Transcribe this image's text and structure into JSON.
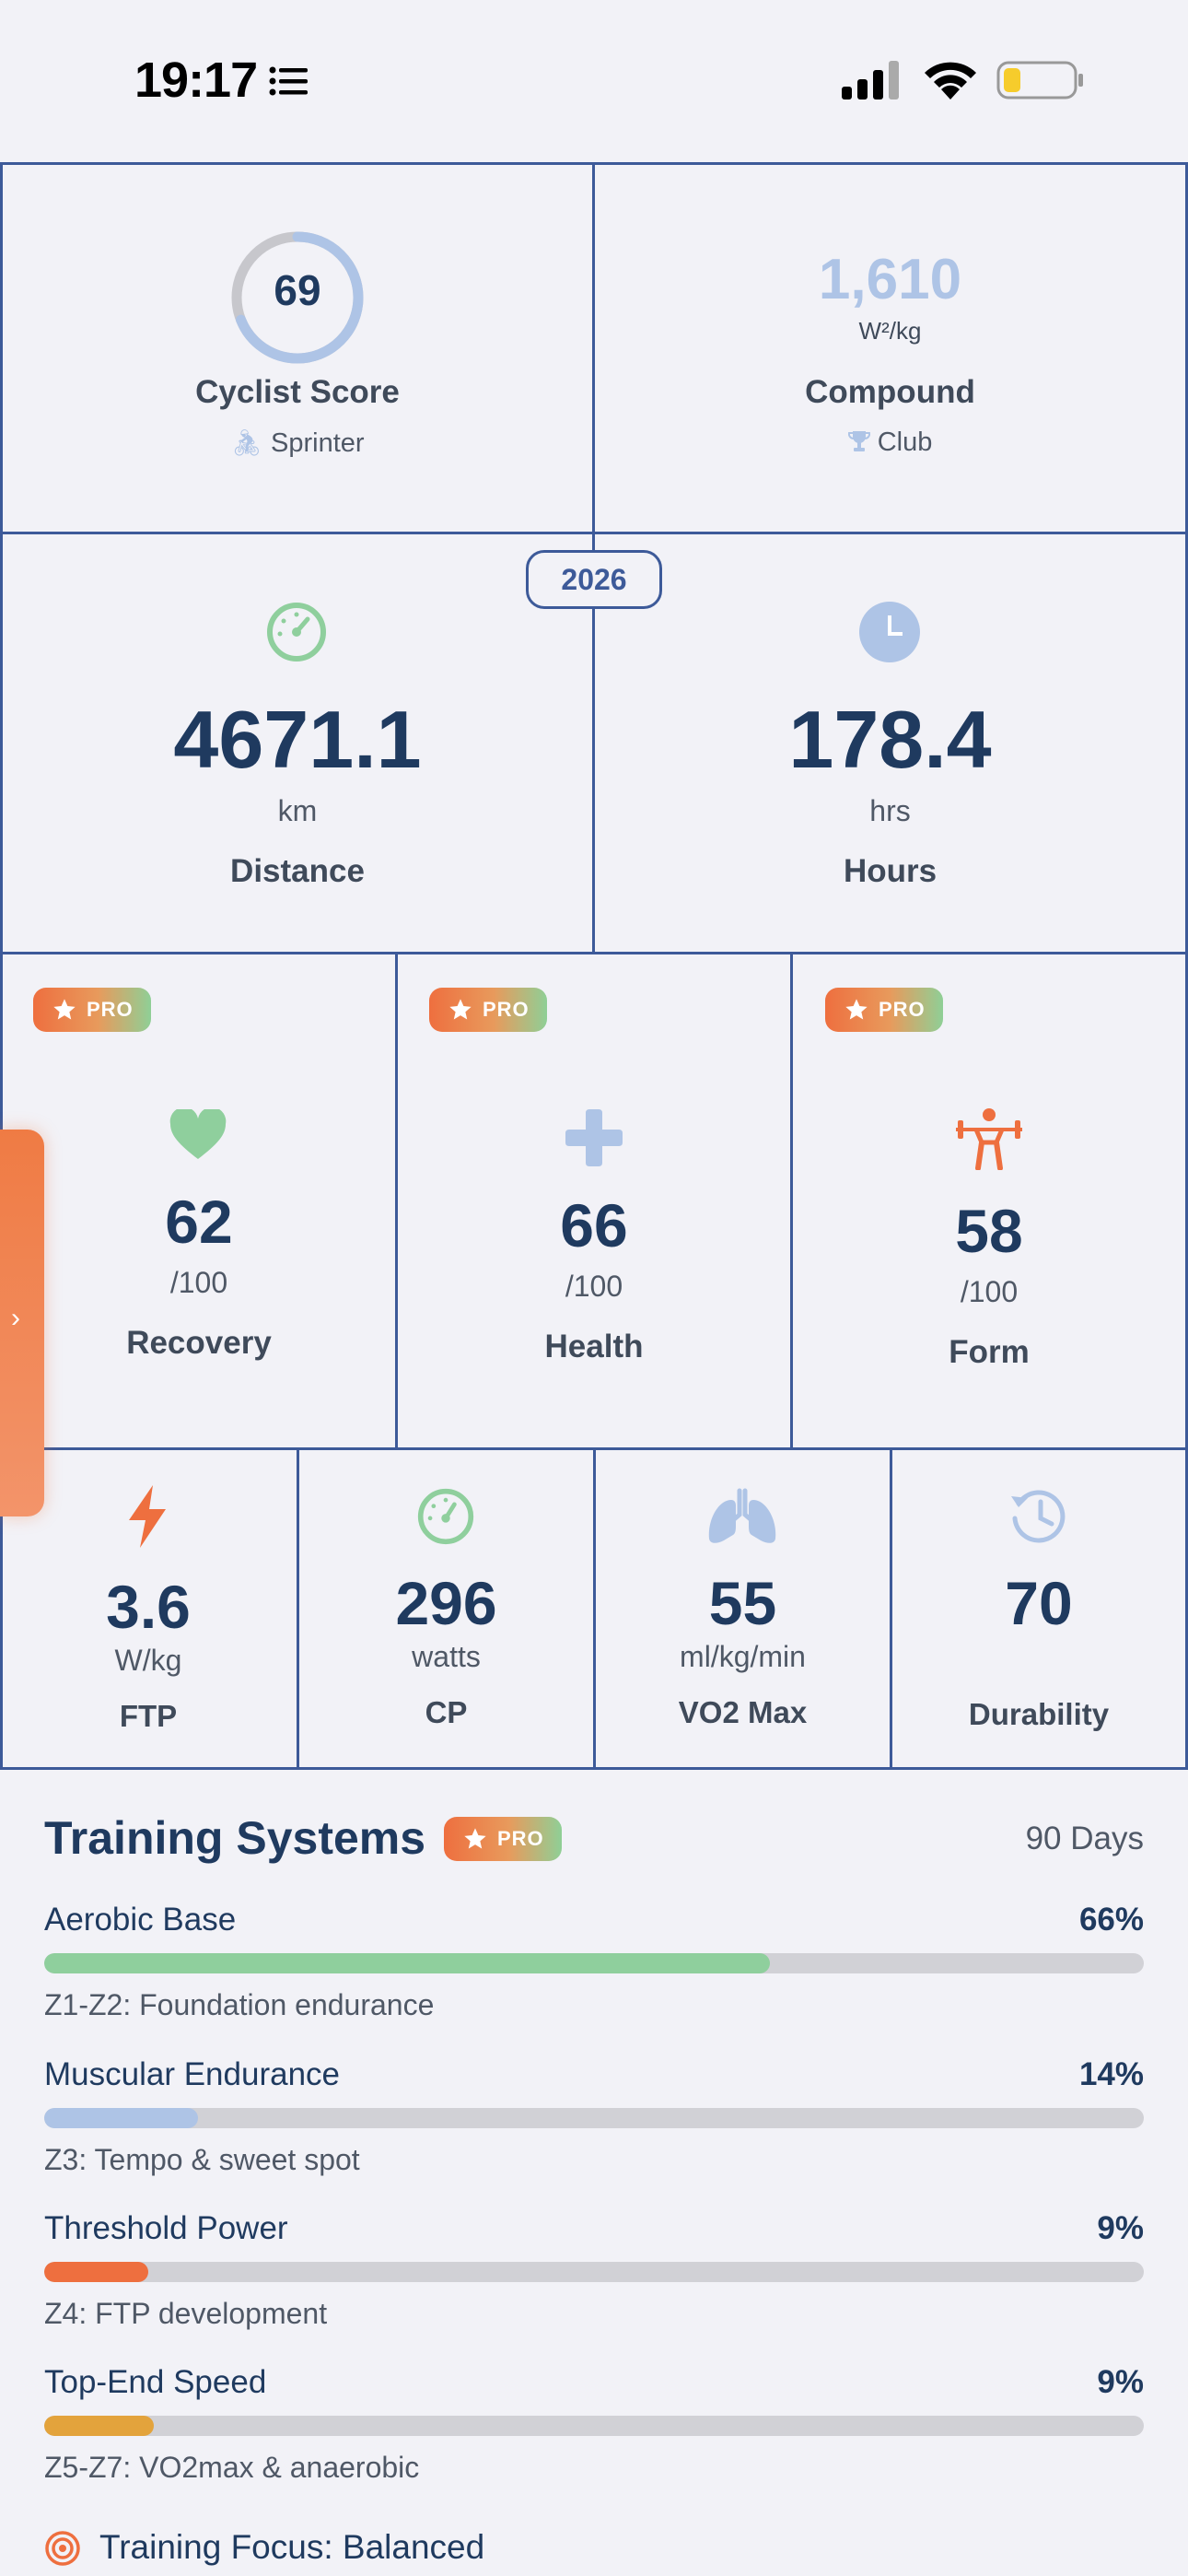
{
  "status": {
    "time": "19:17"
  },
  "score": {
    "value": "69",
    "label": "Cyclist Score",
    "type": "Sprinter",
    "fraction": 0.69
  },
  "compound": {
    "value": "1,610",
    "unit": "W²/kg",
    "label": "Compound",
    "tier": "Club"
  },
  "year": "2026",
  "distance": {
    "value": "4671.1",
    "unit": "km",
    "label": "Distance"
  },
  "hours": {
    "value": "178.4",
    "unit": "hrs",
    "label": "Hours"
  },
  "pro_label": "PRO",
  "wellness": [
    {
      "value": "62",
      "unit": "/100",
      "label": "Recovery"
    },
    {
      "value": "66",
      "unit": "/100",
      "label": "Health"
    },
    {
      "value": "58",
      "unit": "/100",
      "label": "Form"
    }
  ],
  "metrics": [
    {
      "value": "3.6",
      "unit": "W/kg",
      "label": "FTP"
    },
    {
      "value": "296",
      "unit": "watts",
      "label": "CP"
    },
    {
      "value": "55",
      "unit": "ml/kg/min",
      "label": "VO2 Max"
    },
    {
      "value": "70",
      "unit": "",
      "label": "Durability"
    }
  ],
  "training": {
    "title": "Training Systems",
    "period": "90 Days",
    "systems": [
      {
        "name": "Aerobic Base",
        "pct_label": "66%",
        "pct": 66,
        "desc": "Z1-Z2: Foundation endurance",
        "color": "#8fcf9d"
      },
      {
        "name": "Muscular Endurance",
        "pct_label": "14%",
        "pct": 14,
        "desc": "Z3: Tempo & sweet spot",
        "color": "#aec4e6"
      },
      {
        "name": "Threshold Power",
        "pct_label": "9%",
        "pct": 9.5,
        "desc": "Z4: FTP development",
        "color": "#ee6f3f"
      },
      {
        "name": "Top-End Speed",
        "pct_label": "9%",
        "pct": 10,
        "desc": "Z5-Z7: VO2max & anaerobic",
        "color": "#e3a33c"
      }
    ],
    "focus": "Training Focus: Balanced"
  },
  "colors": {
    "border": "#3d5a99",
    "navy": "#1f3a5f",
    "green": "#8fcf9d",
    "blue": "#aec4e6",
    "orange": "#ee6f3f"
  }
}
